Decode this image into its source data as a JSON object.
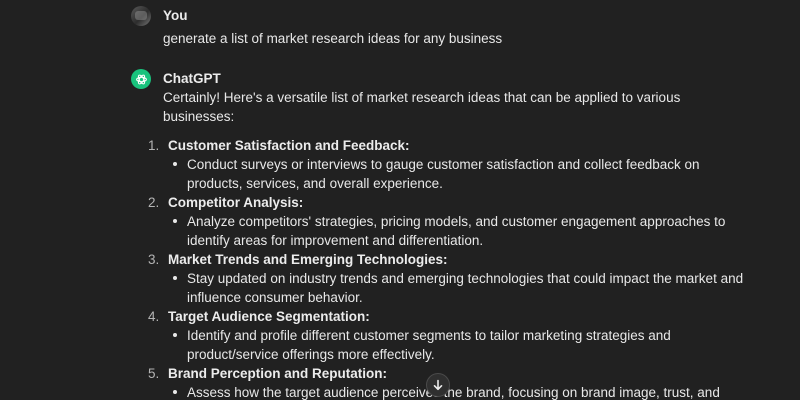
{
  "user_message": {
    "author": "You",
    "text": "generate a list of market research ideas for any business"
  },
  "assistant_message": {
    "author": "ChatGPT",
    "intro": "Certainly! Here's a versatile list of market research ideas that can be applied to various businesses:",
    "ideas": [
      {
        "number": "1.",
        "title": "Customer Satisfaction and Feedback:",
        "detail": "Conduct surveys or interviews to gauge customer satisfaction and collect feedback on products, services, and overall experience."
      },
      {
        "number": "2.",
        "title": "Competitor Analysis:",
        "detail": "Analyze competitors' strategies, pricing models, and customer engagement approaches to identify areas for improvement and differentiation."
      },
      {
        "number": "3.",
        "title": "Market Trends and Emerging Technologies:",
        "detail": "Stay updated on industry trends and emerging technologies that could impact the market and influence consumer behavior."
      },
      {
        "number": "4.",
        "title": "Target Audience Segmentation:",
        "detail": "Identify and profile different customer segments to tailor marketing strategies and product/service offerings more effectively."
      },
      {
        "number": "5.",
        "title": "Brand Perception and Reputation:",
        "detail": "Assess how the target audience perceives the brand, focusing on brand image, trust, and"
      }
    ]
  },
  "icons": {
    "user_avatar": "user-avatar",
    "assistant_avatar": "openai-logo-icon",
    "scroll": "arrow-down-icon"
  },
  "colors": {
    "background": "#212121",
    "text": "#ececec",
    "assistant_avatar_bg": "#19c37d",
    "list_number": "#b4b4b4"
  }
}
